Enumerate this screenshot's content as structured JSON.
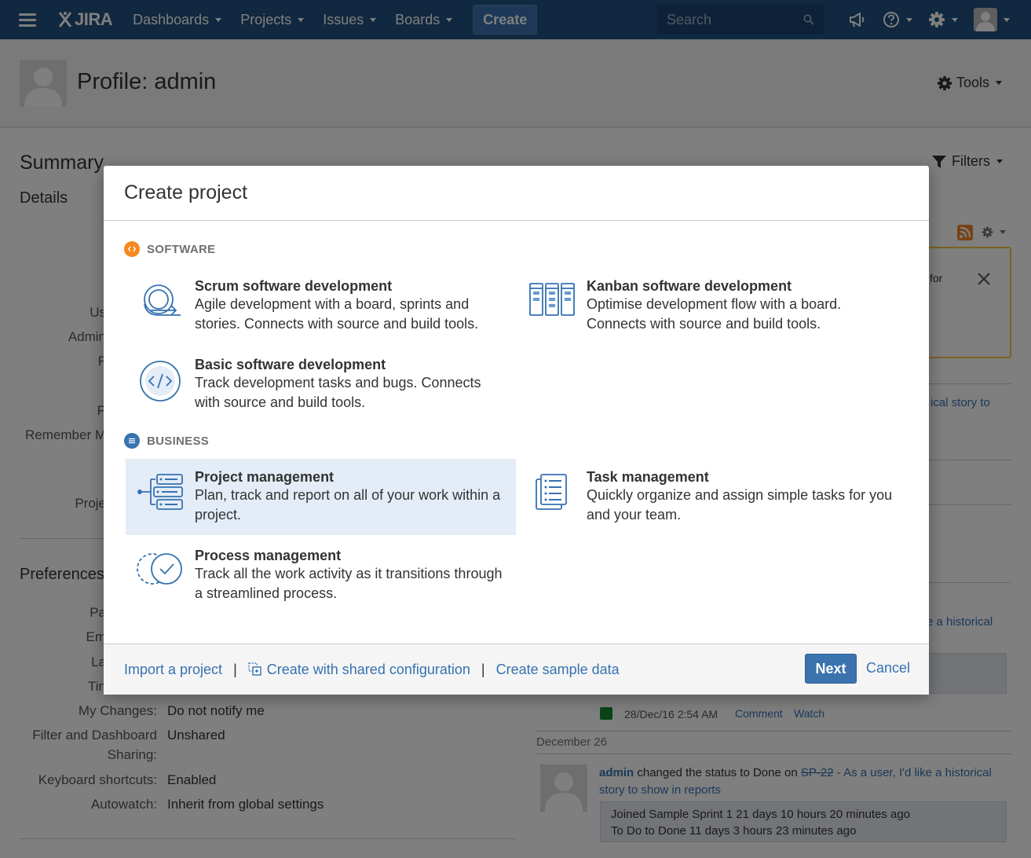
{
  "topnav": {
    "logo": "JIRA",
    "items": [
      "Dashboards",
      "Projects",
      "Issues",
      "Boards"
    ],
    "create_label": "Create",
    "search_placeholder": "Search"
  },
  "page": {
    "title": "Profile: admin",
    "tools_label": "Tools",
    "summary": "Summary",
    "details": "Details",
    "filters_label": "Filters",
    "preferences": "Preferences",
    "detail_labels": [
      "Us",
      "Admin",
      "F",
      "P",
      "Remember M",
      "Proje"
    ],
    "pref_rows": [
      {
        "label": "Pa",
        "value": ""
      },
      {
        "label": "Em",
        "value": ""
      },
      {
        "label": "La",
        "value": ""
      },
      {
        "label": "Tin",
        "value": ""
      },
      {
        "label": "My Changes:",
        "value": "Do not notify me"
      },
      {
        "label": "Filter and Dashboard",
        "value": "Unshared"
      },
      {
        "label": "Sharing:",
        "value": ""
      },
      {
        "label": "Keyboard shortcuts:",
        "value": "Enabled"
      },
      {
        "label": "Autowatch:",
        "value": "Inherit from global settings"
      }
    ],
    "activity": {
      "warn_text": "for",
      "link1": "ical story to",
      "link2": "e a historical",
      "timestamp": "28/Dec/16 2:54 AM",
      "comment": "Comment",
      "watch": "Watch",
      "date_header": "December 26",
      "user": "admin",
      "action": "changed the status to Done on",
      "issue_key": "SP-22",
      "issue_title_1": "- As a user, I'd like a historical",
      "issue_title_2": "story to show in reports",
      "detail_1": "Joined Sample Sprint 1 21 days 10 hours 20 minutes ago",
      "detail_2": "To Do to Done 11 days 3 hours 23 minutes ago"
    }
  },
  "modal": {
    "title": "Create project",
    "software_heading": "SOFTWARE",
    "business_heading": "BUSINESS",
    "options": {
      "scrum": {
        "title": "Scrum software development",
        "desc": "Agile development with a board, sprints and stories. Connects with source and build tools."
      },
      "kanban": {
        "title": "Kanban software development",
        "desc": "Optimise development flow with a board. Connects with source and build tools."
      },
      "basic": {
        "title": "Basic software development",
        "desc": "Track development tasks and bugs. Connects with source and build tools."
      },
      "project": {
        "title": "Project management",
        "desc": "Plan, track and report on all of your work within a project."
      },
      "task": {
        "title": "Task management",
        "desc": "Quickly organize and assign simple tasks for you and your team."
      },
      "process": {
        "title": "Process management",
        "desc": "Track all the work activity as it transitions through a streamlined process."
      }
    },
    "footer": {
      "import": "Import a project",
      "shared": "Create with shared configuration",
      "sample": "Create sample data",
      "next": "Next",
      "cancel": "Cancel"
    }
  },
  "colors": {
    "nav": "#205081",
    "accent": "#3b73af",
    "link": "#3572b0",
    "software_badge": "#f6891f",
    "business_badge": "#3b73af",
    "selected_bg": "#e4ecf7"
  }
}
